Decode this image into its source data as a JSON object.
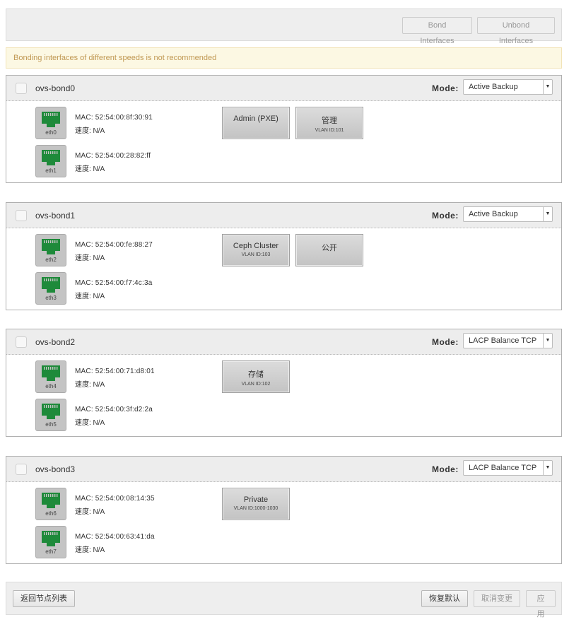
{
  "toolbar": {
    "bond_label": "Bond Interfaces",
    "unbond_label": "Unbond Interfaces"
  },
  "alert": {
    "message": "Bonding interfaces of different speeds is not recommended"
  },
  "mode_label": "Mode:",
  "bonds": [
    {
      "name": "ovs-bond0",
      "mode": "Active Backup",
      "interfaces": [
        {
          "name": "eth0",
          "mac": "MAC: 52:54:00:8f:30:91",
          "speed": "速度: N/A"
        },
        {
          "name": "eth1",
          "mac": "MAC: 52:54:00:28:82:ff",
          "speed": "速度: N/A"
        }
      ],
      "networks": [
        {
          "name": "Admin (PXE)",
          "vlan": ""
        },
        {
          "name": "管理",
          "vlan": "VLAN ID:101"
        }
      ]
    },
    {
      "name": "ovs-bond1",
      "mode": "Active Backup",
      "interfaces": [
        {
          "name": "eth2",
          "mac": "MAC: 52:54:00:fe:88:27",
          "speed": "速度: N/A"
        },
        {
          "name": "eth3",
          "mac": "MAC: 52:54:00:f7:4c:3a",
          "speed": "速度: N/A"
        }
      ],
      "networks": [
        {
          "name": "Ceph Cluster",
          "vlan": "VLAN ID:103"
        },
        {
          "name": "公开",
          "vlan": ""
        }
      ]
    },
    {
      "name": "ovs-bond2",
      "mode": "LACP Balance TCP",
      "interfaces": [
        {
          "name": "eth4",
          "mac": "MAC: 52:54:00:71:d8:01",
          "speed": "速度: N/A"
        },
        {
          "name": "eth5",
          "mac": "MAC: 52:54:00:3f:d2:2a",
          "speed": "速度: N/A"
        }
      ],
      "networks": [
        {
          "name": "存储",
          "vlan": "VLAN ID:102"
        }
      ]
    },
    {
      "name": "ovs-bond3",
      "mode": "LACP Balance TCP",
      "interfaces": [
        {
          "name": "eth6",
          "mac": "MAC: 52:54:00:08:14:35",
          "speed": "速度: N/A"
        },
        {
          "name": "eth7",
          "mac": "MAC: 52:54:00:63:41:da",
          "speed": "速度: N/A"
        }
      ],
      "networks": [
        {
          "name": "Private",
          "vlan": "VLAN ID:1000-1030"
        }
      ]
    }
  ],
  "footer": {
    "back_label": "返回节点列表",
    "restore_label": "恢复默认",
    "cancel_label": "取消变更",
    "apply_label": "应用"
  },
  "icons": {
    "port": "ethernet-port-icon",
    "arrow": "chevron-down-icon"
  },
  "colors": {
    "port_green": "#1e8a3a",
    "alert_text": "#c09853"
  }
}
